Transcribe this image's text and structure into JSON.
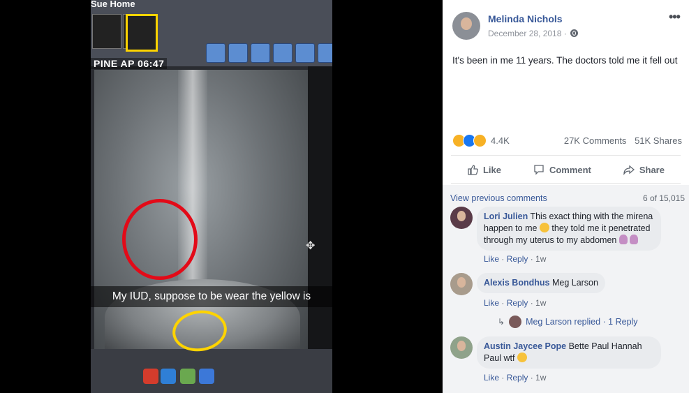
{
  "photo": {
    "topbar_text": "Sue Home",
    "label_tag": "PINE AP 06:47",
    "caption": "My IUD, suppose to be wear the yellow is"
  },
  "post": {
    "author": "Melinda Nichols",
    "date": "December 28, 2018 ·",
    "text": "It's been in me 11 years. The doctors told me it fell out",
    "reaction_count": "4.4K",
    "comments_count": "27K Comments",
    "shares_count": "51K Shares",
    "actions": {
      "like": "Like",
      "comment": "Comment",
      "share": "Share"
    },
    "icons": {
      "more": "more-options-icon",
      "globe": "globe-icon"
    }
  },
  "comments": {
    "view_previous": "View previous comments",
    "count_of": "6 of 15,015",
    "items": [
      {
        "name": "Lori Julien",
        "text_1": "This exact thing with the mirena happen to me",
        "text_2": "they told me it penetrated through my uterus to my abdomen",
        "like": "Like",
        "reply": "Reply",
        "time": "1w"
      },
      {
        "name": "Alexis Bondhus",
        "text": "Meg Larson",
        "like": "Like",
        "reply": "Reply",
        "time": "1w",
        "replied": "Meg Larson replied · 1 Reply"
      },
      {
        "name": "Austin Jaycee Pope",
        "text": "Bette Paul Hannah Paul wtf",
        "like": "Like",
        "reply": "Reply",
        "time": "1w"
      }
    ]
  },
  "colors": {
    "link": "#385898",
    "muted": "#606770",
    "comment_bg": "#e9ebee",
    "red_circle": "#e30a18",
    "yellow_circle": "#ffd400"
  }
}
